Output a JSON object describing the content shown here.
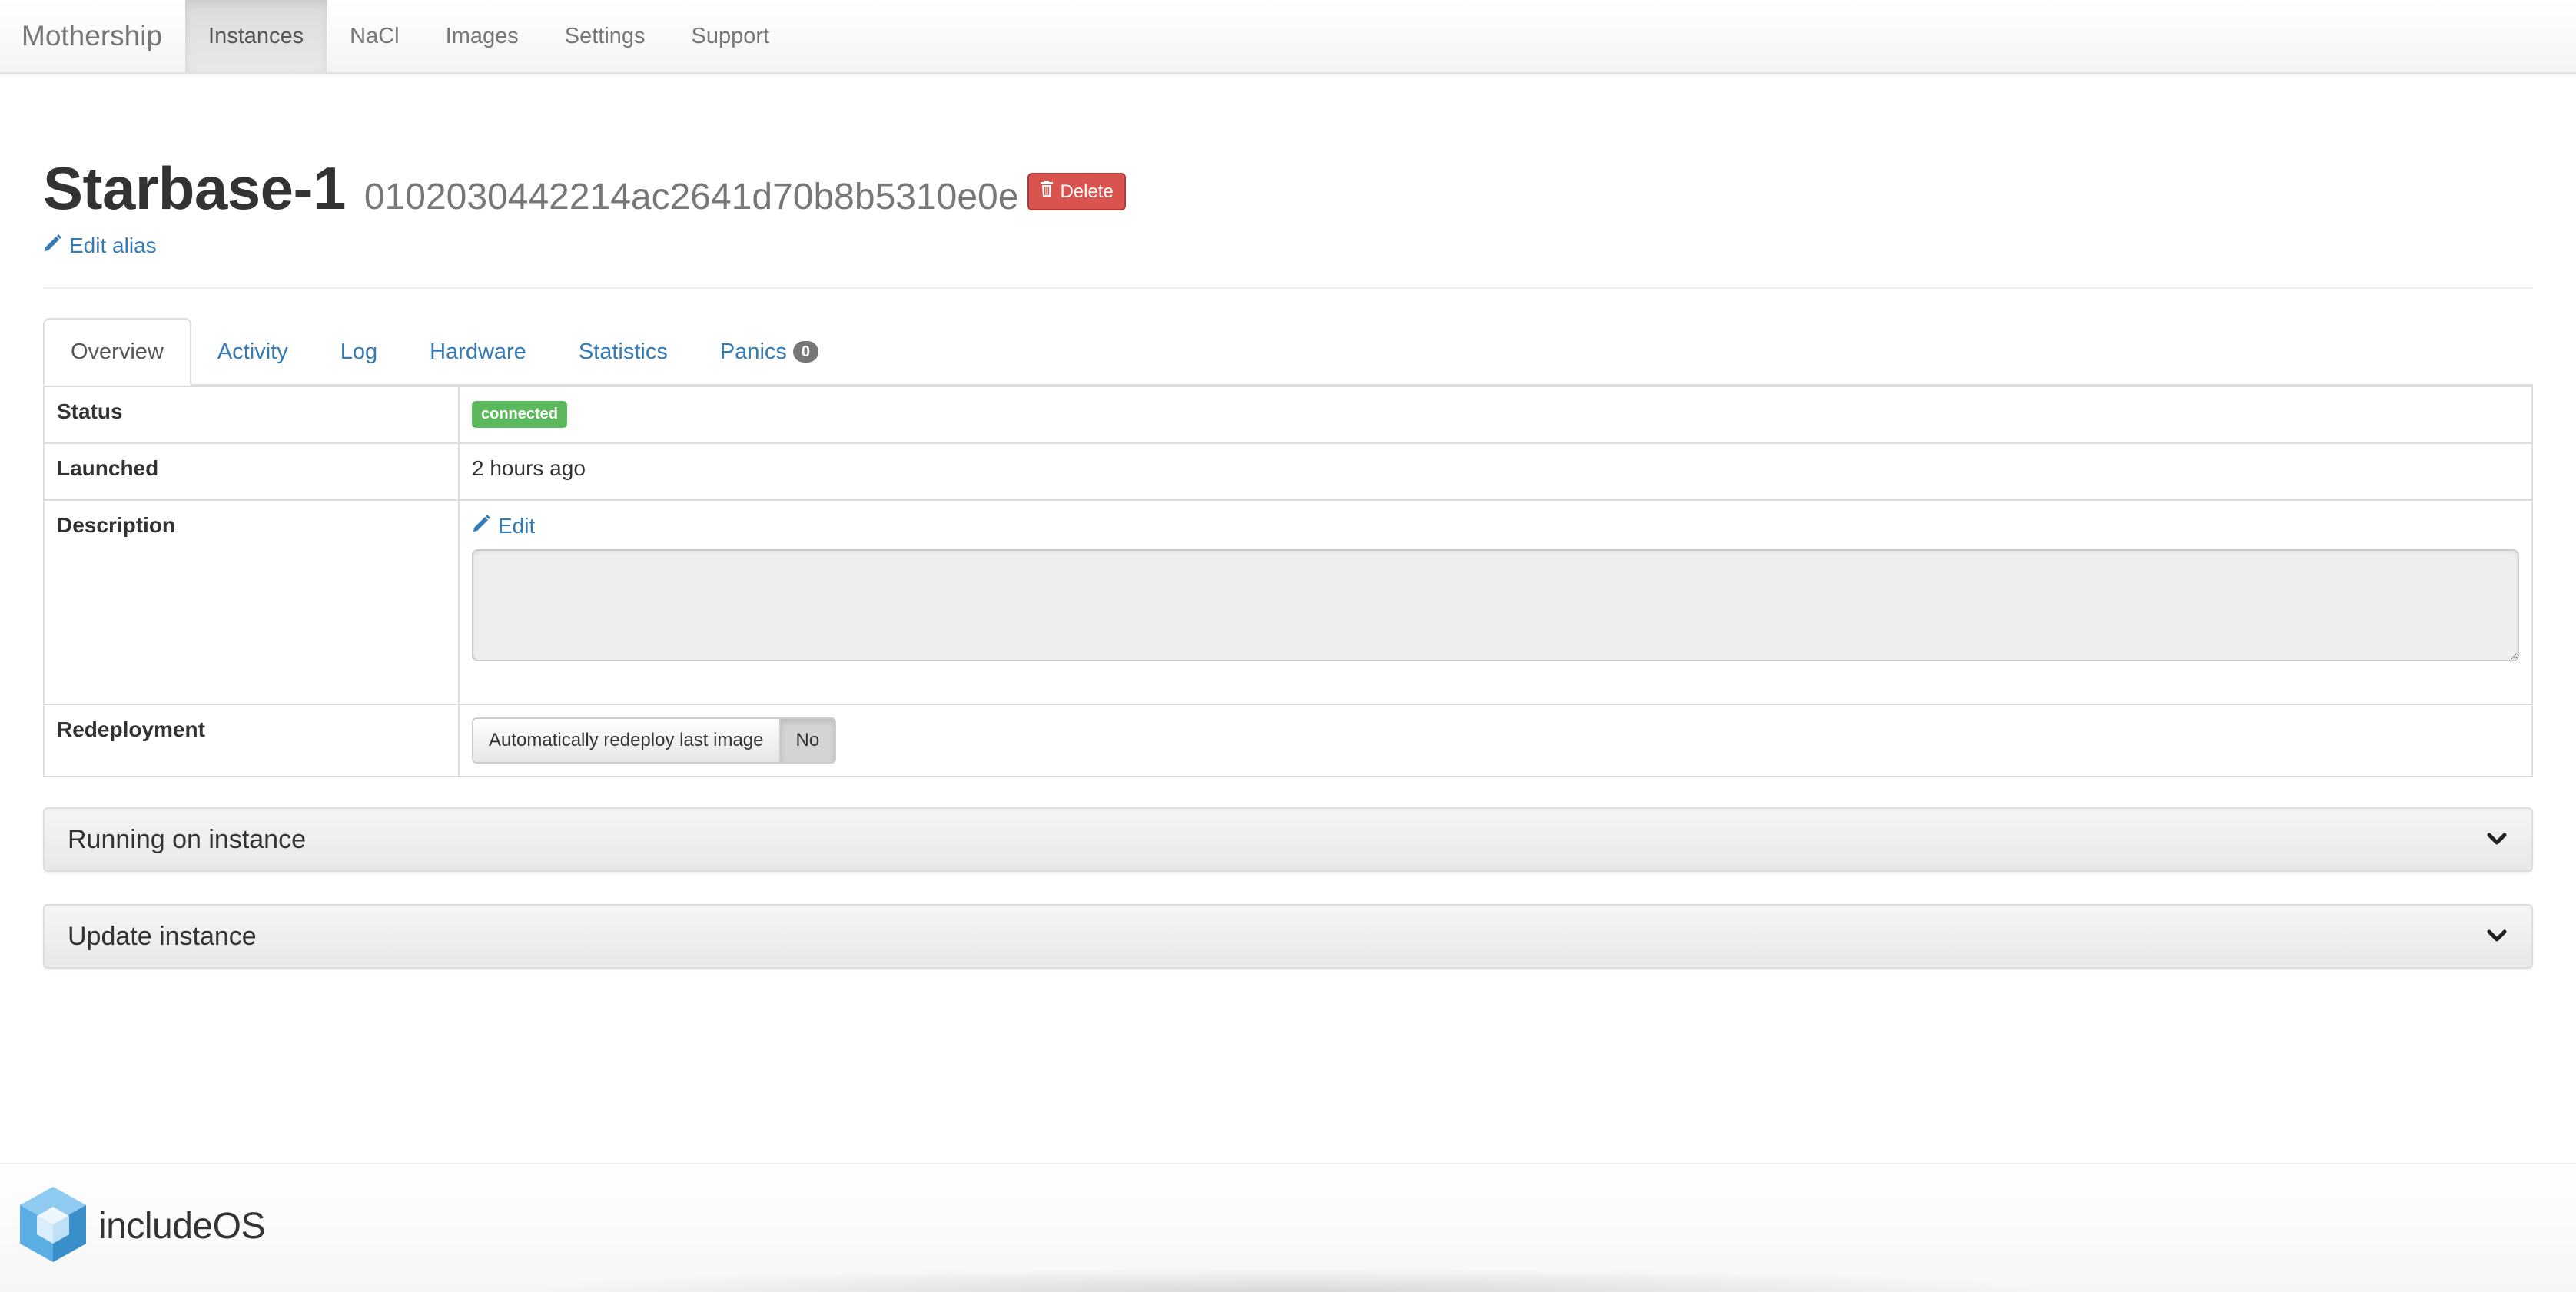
{
  "navbar": {
    "brand": "Mothership",
    "items": [
      {
        "label": "Instances",
        "active": true
      },
      {
        "label": "NaCl",
        "active": false
      },
      {
        "label": "Images",
        "active": false
      },
      {
        "label": "Settings",
        "active": false
      },
      {
        "label": "Support",
        "active": false
      }
    ]
  },
  "header": {
    "title": "Starbase-1",
    "instance_id": "0102030442214ac2641d70b8b5310e0e",
    "delete_label": "Delete",
    "edit_alias_label": "Edit alias"
  },
  "tabs": [
    {
      "label": "Overview",
      "active": true
    },
    {
      "label": "Activity",
      "active": false
    },
    {
      "label": "Log",
      "active": false
    },
    {
      "label": "Hardware",
      "active": false
    },
    {
      "label": "Statistics",
      "active": false
    },
    {
      "label": "Panics",
      "active": false,
      "badge": "0"
    }
  ],
  "details": {
    "status": {
      "label": "Status",
      "value": "connected",
      "color": "#5cb85c"
    },
    "launched": {
      "label": "Launched",
      "value": "2 hours ago"
    },
    "description": {
      "label": "Description",
      "edit_label": "Edit",
      "value": ""
    },
    "redeployment": {
      "label": "Redeployment",
      "toggle_label": "Automatically redeploy last image",
      "toggle_value": "No"
    }
  },
  "panels": [
    {
      "title": "Running on instance",
      "icon": "chevron-down-icon"
    },
    {
      "title": "Update instance",
      "icon": "chevron-down-icon"
    }
  ],
  "footer": {
    "logo_text_1": "include",
    "logo_text_2": "OS"
  },
  "colors": {
    "link": "#337ab7",
    "danger": "#d9534f",
    "success": "#5cb85c",
    "badge": "#777777"
  }
}
